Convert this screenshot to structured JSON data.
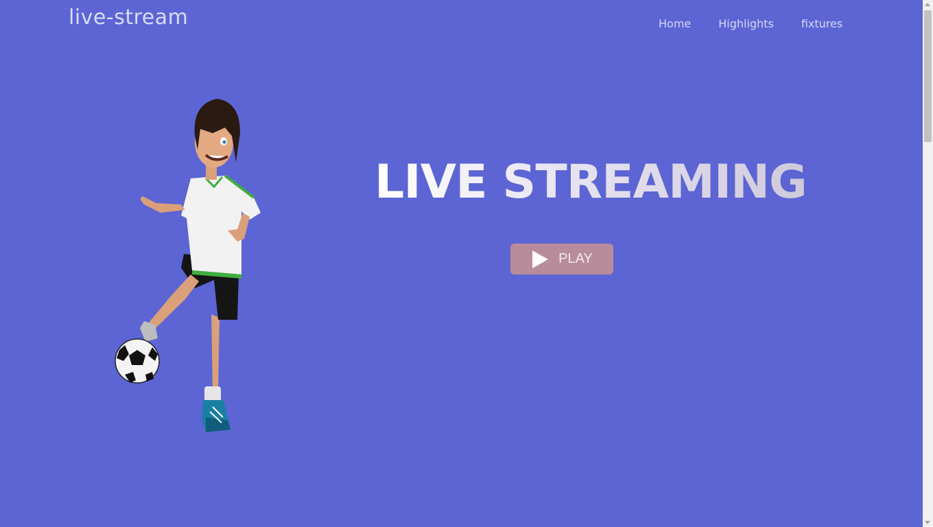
{
  "header": {
    "brand": "live-stream",
    "nav": [
      "Home",
      "Highlights",
      "fixtures"
    ]
  },
  "hero": {
    "title": "LIVE STREAMING",
    "play_label": "PLAY",
    "play_icon": "play-icon"
  },
  "illustration": {
    "icon": "soccer-player-illustration"
  },
  "colors": {
    "background": "#5c65d3",
    "play_button": "#b88c9a"
  }
}
